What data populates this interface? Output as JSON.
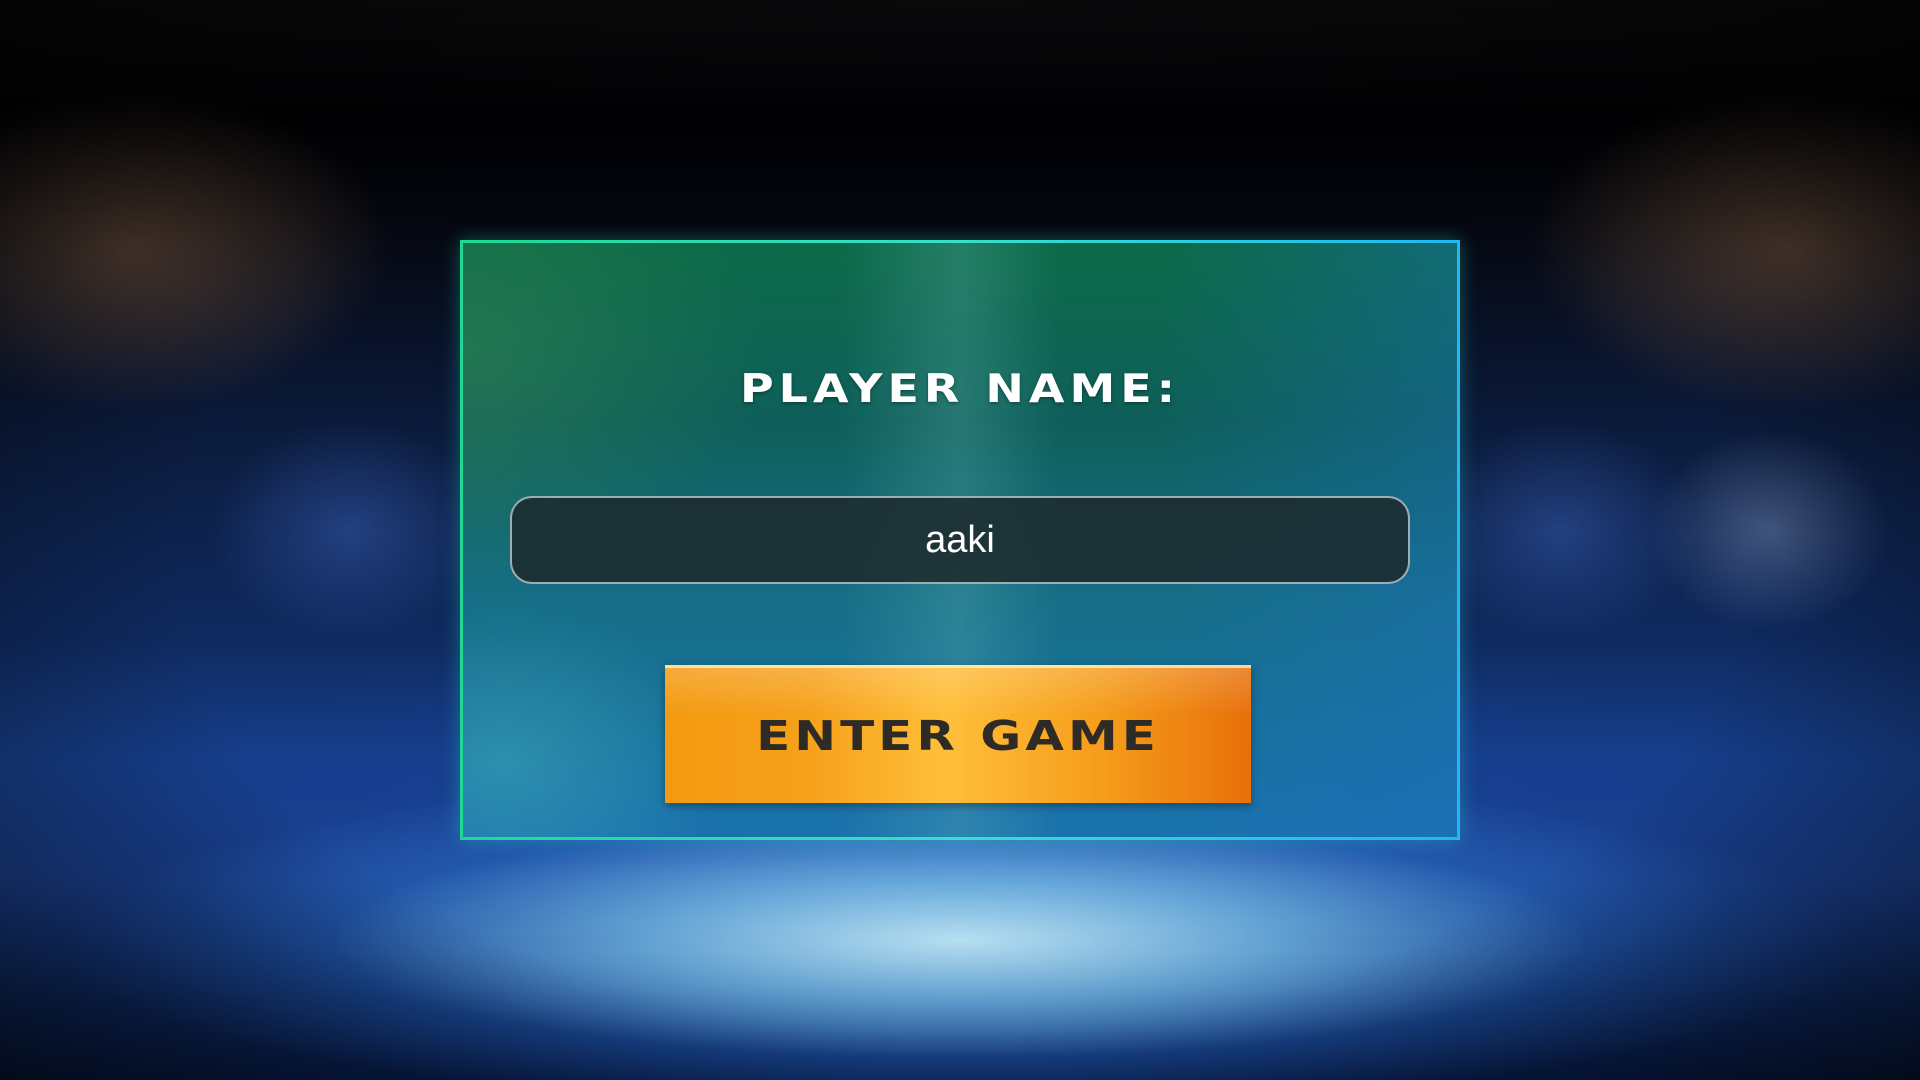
{
  "login": {
    "title": "PLAYER NAME:",
    "name_value": "aaki",
    "enter_label": "ENTER GAME"
  },
  "colors": {
    "panel_border": "#1fd894",
    "button_orange": "#f7a11c",
    "button_text": "#2e2a26",
    "title_text": "#ffffff"
  }
}
